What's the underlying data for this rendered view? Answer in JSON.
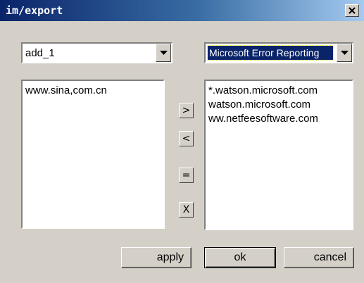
{
  "window": {
    "title": "im/export"
  },
  "left": {
    "combo_value": "add_1",
    "list_items": [
      "www.sina,com.cn"
    ]
  },
  "right": {
    "combo_value": "Microsoft Error Reporting",
    "list_items": [
      "*.watson.microsoft.com",
      "watson.microsoft.com",
      "ww.netfeesoftware.com"
    ]
  },
  "middle_buttons": {
    "add": ">",
    "remove": "<",
    "equal": "=",
    "delete": "X"
  },
  "buttons": {
    "apply": "apply",
    "ok": "ok",
    "cancel": "cancel"
  },
  "colors": {
    "title_start": "#0a246a",
    "title_end": "#a6caf0",
    "selection": "#0a246a",
    "dialog_bg": "#d4d0c8"
  },
  "icons": [
    "close-icon",
    "dropdown-arrow-icon"
  ]
}
